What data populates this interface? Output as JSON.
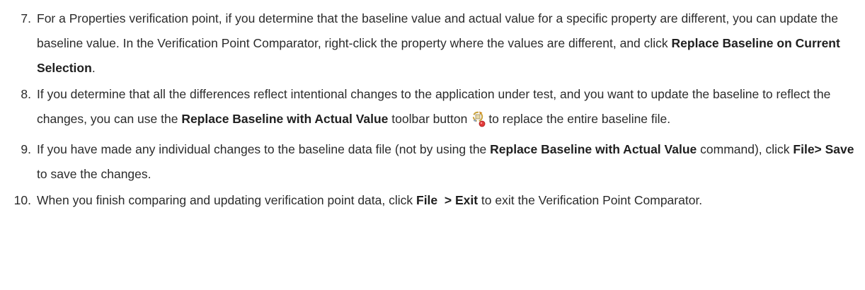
{
  "steps": [
    {
      "number": "7.",
      "t1": "For a Properties verification point, if you determine that the baseline value and actual value for a specific property are different, you can update the baseline value. In the Verification Point Comparator, right-click the property where the values are different, and click ",
      "b1": "Replace Baseline on Current Selection",
      "t2": "."
    },
    {
      "number": "8.",
      "t1": "If you determine that all the differences reflect intentional changes to the application under test, and you want to update the baseline to reflect the changes, you can use the ",
      "b1": "Replace Baseline with Actual Value",
      "t2": " toolbar button",
      "icon": "replace-baseline-icon",
      "t3": "to replace the entire baseline file."
    },
    {
      "number": "9.",
      "t1": "If you have made any individual changes to the baseline data file (not by using the ",
      "b1": "Replace Baseline with Actual Value",
      "t2": " command), click ",
      "b2": "File> Save",
      "t3": " to save the changes."
    },
    {
      "number": "10.",
      "t1": "When you finish comparing and updating verification point data, click ",
      "b1": "File  > Exit",
      "t2": " to exit the Verification Point Comparator."
    }
  ]
}
